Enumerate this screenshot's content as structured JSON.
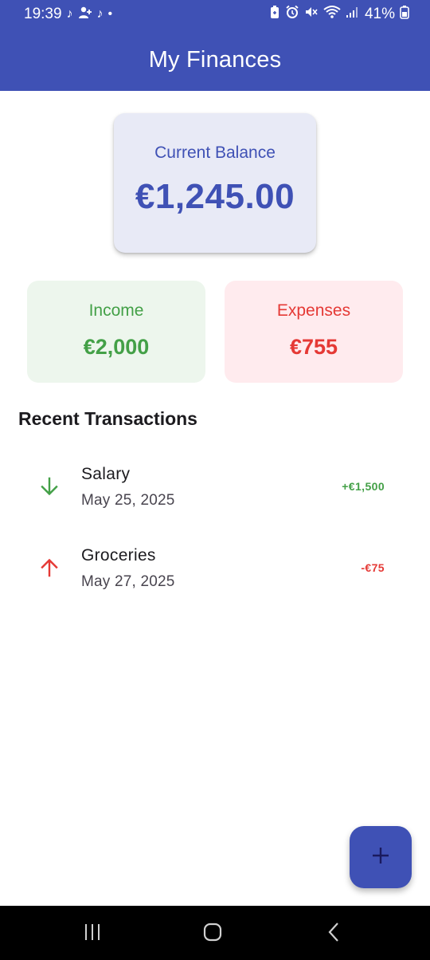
{
  "status_bar": {
    "time": "19:39",
    "battery": "41%",
    "left_icons": [
      "tiktok-icon",
      "person-add-icon",
      "tiktok-icon",
      "dot-icon"
    ],
    "right_icons": [
      "battery-saver-icon",
      "alarm-icon",
      "mute-icon",
      "wifi-icon",
      "signal-icon",
      "battery-icon"
    ]
  },
  "app_bar": {
    "title": "My Finances"
  },
  "balance": {
    "label": "Current Balance",
    "amount": "€1,245.00"
  },
  "income": {
    "label": "Income",
    "amount": "€2,000"
  },
  "expenses": {
    "label": "Expenses",
    "amount": "€755"
  },
  "transactions": {
    "title": "Recent Transactions",
    "items": [
      {
        "title": "Salary",
        "date": "May 25, 2025",
        "amount": "+€1,500",
        "icon": "arrow-down-icon",
        "type": "income"
      },
      {
        "title": "Groceries",
        "date": "May 27, 2025",
        "amount": "-€75",
        "icon": "arrow-up-icon",
        "type": "expense"
      }
    ]
  },
  "fab": {
    "icon": "plus-icon"
  },
  "nav": {
    "icons": [
      "recents-icon",
      "home-icon",
      "back-icon"
    ]
  },
  "colors": {
    "primary": "#3f51b5",
    "balance_bg": "#e8eaf6",
    "income": "#43a047",
    "income_bg": "#edf6ed",
    "expense": "#e53935",
    "expense_bg": "#ffebee"
  }
}
